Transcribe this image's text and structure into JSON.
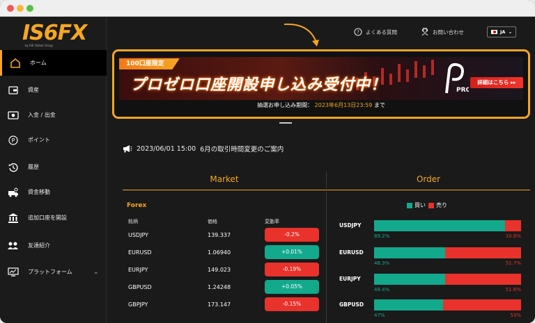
{
  "colors": {
    "accent": "#f5a623",
    "buy": "#12a98d",
    "sell": "#e8322b",
    "bg": "#1a1a1a"
  },
  "sidebar": {
    "logo": "IS6FX",
    "logo_sub": "by IS6 Global Group",
    "items": [
      {
        "label": "ホーム",
        "icon": "home-icon"
      },
      {
        "label": "資産",
        "icon": "wallet-icon"
      },
      {
        "label": "入金 / 出金",
        "icon": "cash-icon"
      },
      {
        "label": "ポイント",
        "icon": "point-icon"
      },
      {
        "label": "履歴",
        "icon": "history-icon"
      },
      {
        "label": "資金移動",
        "icon": "transfer-icon"
      },
      {
        "label": "追加口座を開設",
        "icon": "bank-icon"
      },
      {
        "label": "友達紹介",
        "icon": "friends-icon"
      },
      {
        "label": "プラットフォーム",
        "icon": "monitor-icon"
      }
    ]
  },
  "header": {
    "faq": "よくある質問",
    "contact": "お問い合わせ",
    "lang": "JA"
  },
  "banner": {
    "tag": "100口座限定",
    "title": "プロゼロ口座開設申し込み受付中！",
    "logo_text": "PRO",
    "button": "詳細はこちら ▸▸",
    "period_label": "抽選お申し込み期間：",
    "period_value": "2023年6月13日23:59",
    "period_suffix": "まで"
  },
  "notice": {
    "date": "2023/06/01 15:00",
    "text": "6月の取引時間変更のご案内"
  },
  "market": {
    "title": "Market",
    "category": "Forex",
    "columns": [
      "銘柄",
      "価格",
      "変動率"
    ],
    "rows": [
      {
        "symbol": "USDJPY",
        "price": "139.337",
        "change": "-0.2%"
      },
      {
        "symbol": "EURUSD",
        "price": "1.06940",
        "change": "+0.01%"
      },
      {
        "symbol": "EURJPY",
        "price": "149.023",
        "change": "-0.19%"
      },
      {
        "symbol": "GBPUSD",
        "price": "1.24248",
        "change": "+0.05%"
      },
      {
        "symbol": "GBPJPY",
        "price": "173.147",
        "change": "-0.15%"
      }
    ]
  },
  "order": {
    "title": "Order",
    "legend_buy": "買い",
    "legend_sell": "売り",
    "rows": [
      {
        "symbol": "USDJPY",
        "buy": 89.2,
        "buy_label": "89.2%",
        "sell_label": "10.8%"
      },
      {
        "symbol": "EURUSD",
        "buy": 48.3,
        "buy_label": "48.3%",
        "sell_label": "51.7%"
      },
      {
        "symbol": "EURJPY",
        "buy": 48.4,
        "buy_label": "48.4%",
        "sell_label": "51.6%"
      },
      {
        "symbol": "GBPUSD",
        "buy": 47,
        "buy_label": "47%",
        "sell_label": "53%"
      }
    ]
  }
}
